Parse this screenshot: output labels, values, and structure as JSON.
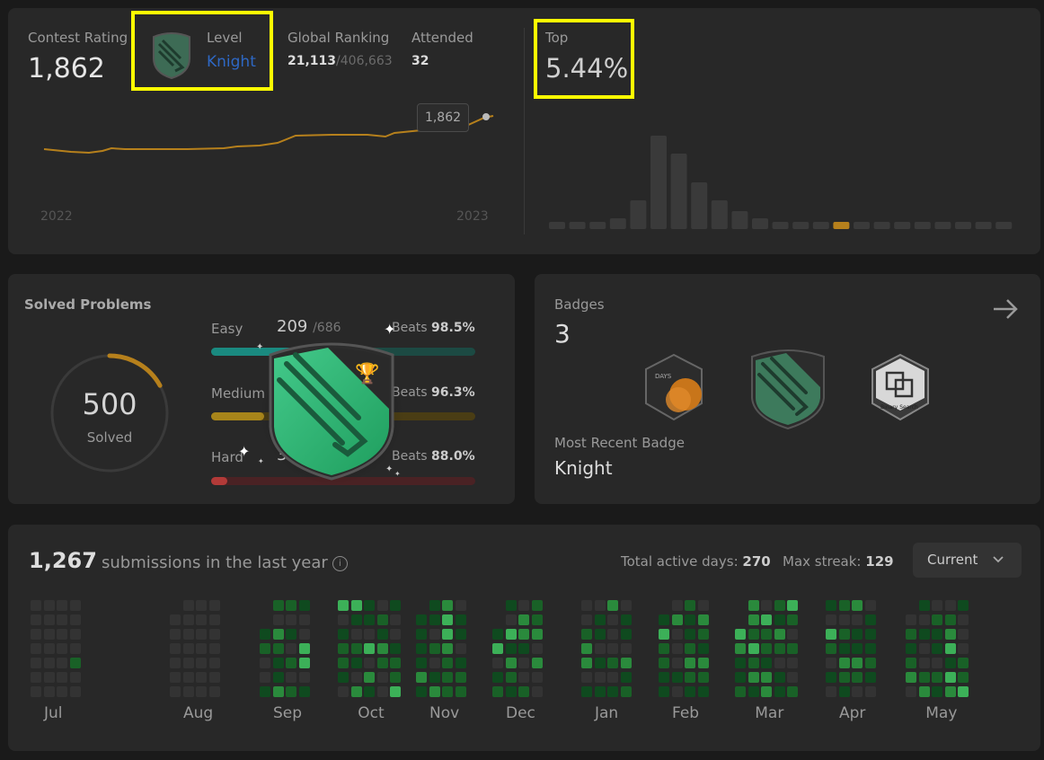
{
  "contest": {
    "rating_label": "Contest Rating",
    "rating_value": "1,862",
    "level_label": "Level",
    "level_value": "Knight",
    "global_label": "Global Ranking",
    "global_rank": "21,113",
    "global_total": "/406,663",
    "attended_label": "Attended",
    "attended_value": "32",
    "tooltip": "1,862",
    "x_start": "2022",
    "x_end": "2023",
    "top_label": "Top",
    "top_value": "5.44%",
    "histogram": [
      2,
      2,
      2,
      3,
      8,
      26,
      21,
      13,
      8,
      5,
      3,
      2,
      2,
      2,
      2,
      2,
      2,
      2,
      2,
      2,
      2,
      2,
      2
    ],
    "histogram_highlight_index": 14,
    "accent": "#b6801c"
  },
  "solved": {
    "title": "Solved Problems",
    "total": "500",
    "total_label": "Solved",
    "easy_label": "Easy",
    "easy_count": "209",
    "easy_total": "/686",
    "easy_beats_label": "Beats",
    "easy_beats": "98.5%",
    "easy_ratio": 0.305,
    "medium_label": "Medium",
    "medium_beats_label": "Beats",
    "medium_beats": "96.3%",
    "medium_ratio": 0.2,
    "hard_label": "Hard",
    "hard_count": "36",
    "hard_beats_label": "Beats",
    "hard_beats": "88.0%",
    "hard_ratio": 0.06,
    "ring_progress": 0.17,
    "colors": {
      "easy": "#1cb8b8",
      "medium": "#ffb700",
      "hard": "#ef4743"
    }
  },
  "badges": {
    "title": "Badges",
    "count": "3",
    "recent_label": "Most Recent Badge",
    "recent_value": "Knight",
    "badge_days_text": "DAYS",
    "badge_binary_text": "Binary Search",
    "icons": [
      "days-badge-icon",
      "knight-badge-icon",
      "binary-search-badge-icon"
    ]
  },
  "submissions": {
    "count": "1,267",
    "text": "submissions in the last year",
    "active_label": "Total active days:",
    "active_value": "270",
    "streak_label": "Max streak:",
    "streak_value": "129",
    "dropdown": "Current",
    "months": [
      "Jul",
      "Aug",
      "Sep",
      "Oct",
      "Nov",
      "Dec",
      "Jan",
      "Feb",
      "Mar",
      "Apr",
      "May"
    ]
  }
}
